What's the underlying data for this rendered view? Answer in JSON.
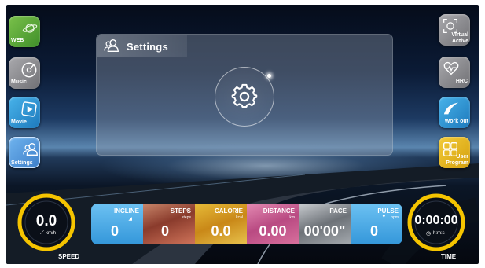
{
  "sidebar_left": [
    {
      "label": "WEB",
      "icon": "planet-icon",
      "color": "#56a83a"
    },
    {
      "label": "Music",
      "icon": "vinyl-icon",
      "color": "#8e8e92"
    },
    {
      "label": "Movie",
      "icon": "play-icon",
      "color": "#2a8fd0"
    },
    {
      "label": "Settings",
      "icon": "users-icon",
      "color": "#4c8ed0"
    }
  ],
  "sidebar_right": [
    {
      "label_line1": "Virtual",
      "label_line2": "Active",
      "icon": "virtual-active-icon",
      "color": "#8e8e92"
    },
    {
      "label_line1": "HRC",
      "label_line2": "",
      "icon": "heart-pulse-icon",
      "color": "#8e8e92"
    },
    {
      "label_line1": "Work out",
      "label_line2": "",
      "icon": "swoosh-icon",
      "color": "#2a8fd0"
    },
    {
      "label_line1": "User",
      "label_line2": "Program",
      "icon": "grid-icon",
      "color": "#e0b11a"
    }
  ],
  "panel": {
    "title": "Settings",
    "icon": "users-icon",
    "button_icon": "gear-icon"
  },
  "speed": {
    "value": "0.0",
    "unit": "km/h",
    "label": "SPEED"
  },
  "time": {
    "value": "0:00:00",
    "unit": "h:m:s",
    "label": "TIME"
  },
  "metrics": [
    {
      "label": "INCLINE",
      "value": "0",
      "unit": ""
    },
    {
      "label": "STEPS",
      "value": "0",
      "unit": "steps"
    },
    {
      "label": "CALORIE",
      "value": "0.0",
      "unit": "kcal"
    },
    {
      "label": "DISTANCE",
      "value": "0.00",
      "unit": "km"
    },
    {
      "label": "PACE",
      "value": "00'00\"",
      "unit": ""
    },
    {
      "label": "PULSE",
      "value": "0",
      "unit": "bpm"
    }
  ],
  "colors": {
    "accent_yellow": "#f5c400",
    "tile_blue": "#45a9e6"
  }
}
